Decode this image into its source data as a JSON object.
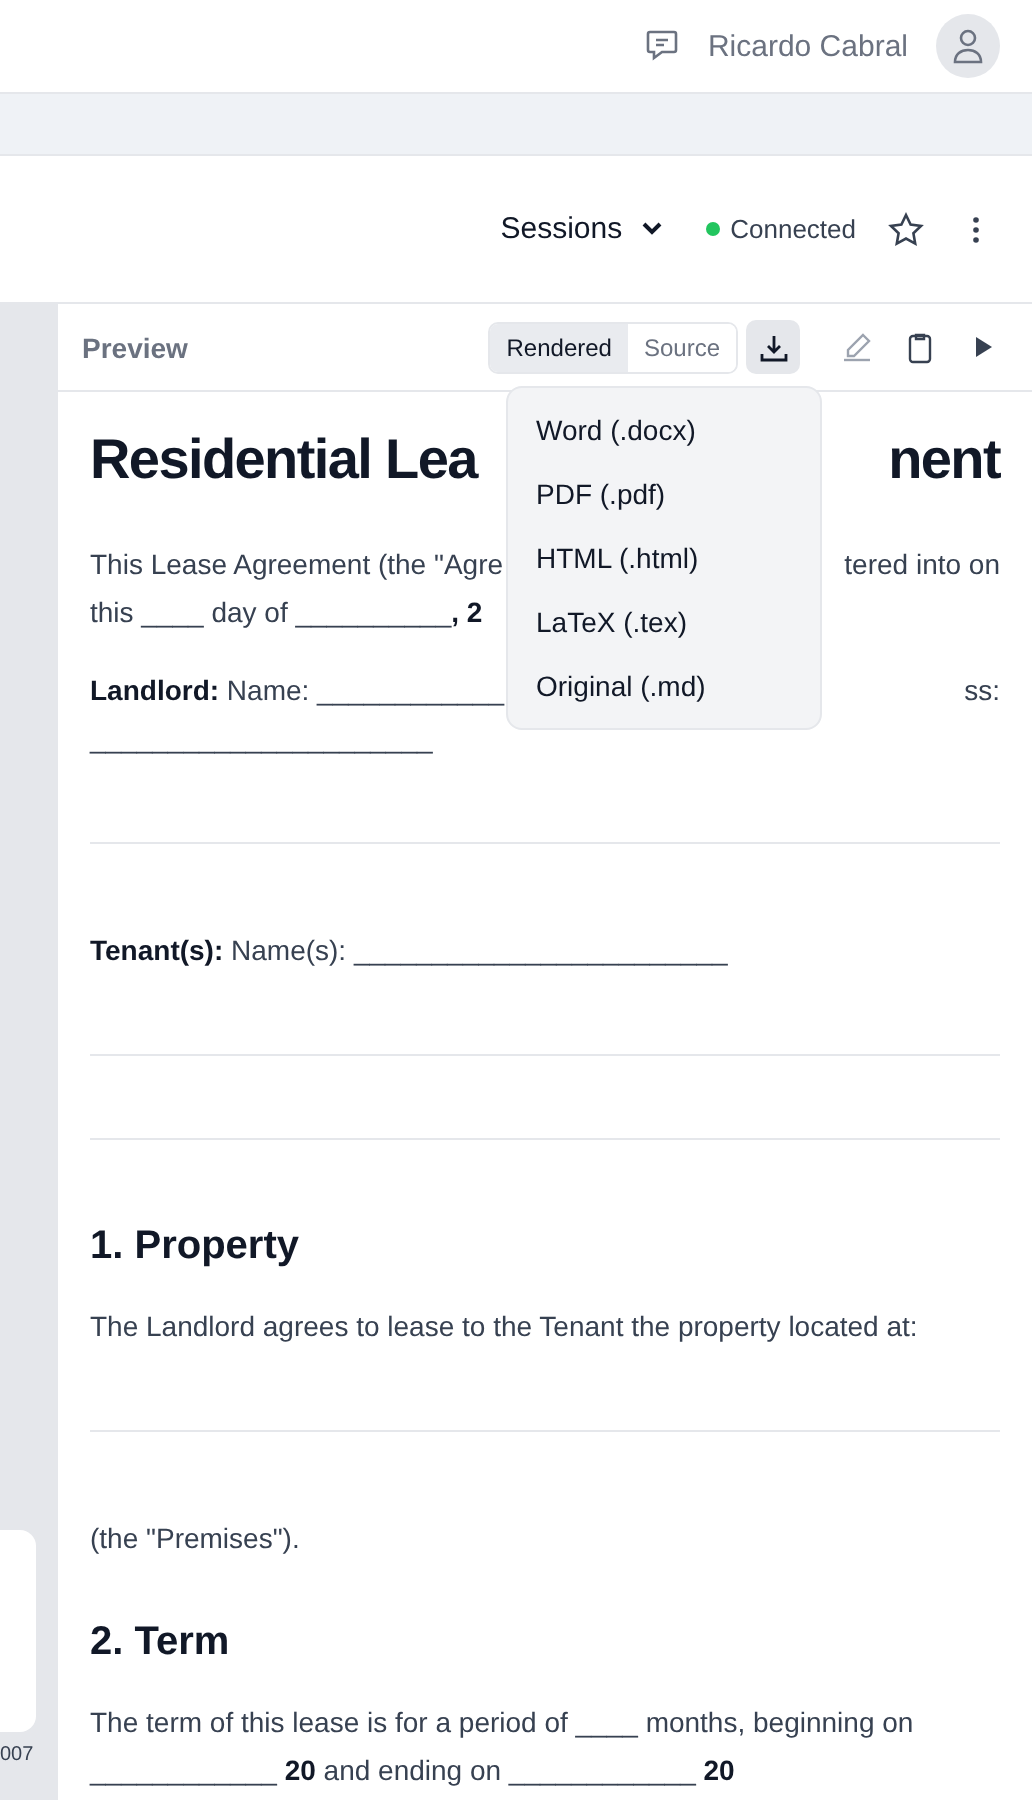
{
  "header": {
    "user_name": "Ricardo Cabral"
  },
  "toolbar": {
    "sessions_label": "Sessions",
    "status": {
      "label": "Connected",
      "color": "#22c55e"
    }
  },
  "side_strip": {
    "caption": "007"
  },
  "preview": {
    "title": "Preview",
    "views": [
      {
        "label": "Rendered",
        "selected": true
      },
      {
        "label": "Source",
        "selected": false
      }
    ],
    "download": {
      "expanded": true,
      "menu": [
        "Word (.docx)",
        "PDF (.pdf)",
        "HTML (.html)",
        "LaTeX (.tex)",
        "Original (.md)"
      ]
    }
  },
  "document": [
    {
      "kind": "title",
      "left": "Residential Lea",
      "right": "nent"
    },
    {
      "kind": "para",
      "lines": [
        {
          "left": "This Lease Agreement (the \"Agre",
          "right": "tered into on"
        },
        {
          "left": "this ____ day of __________**, 2**"
        }
      ]
    },
    {
      "kind": "para",
      "lines": [
        {
          "left": "**Landlord:** Name: ____________",
          "right": "ss:"
        },
        {
          "left": "______________________"
        }
      ]
    },
    {
      "kind": "rule"
    },
    {
      "kind": "para",
      "lines": [
        {
          "left": "**Tenant(s):** Name(s): ________________________"
        }
      ]
    },
    {
      "kind": "rule"
    },
    {
      "kind": "rule"
    },
    {
      "kind": "heading",
      "text": "1. Property"
    },
    {
      "kind": "para",
      "lines": [
        {
          "left": "The Landlord agrees to lease to the Tenant the property located at:"
        }
      ]
    },
    {
      "kind": "rule"
    },
    {
      "kind": "para",
      "lines": [
        {
          "left": "(the \"Premises\")."
        }
      ]
    },
    {
      "kind": "heading",
      "text": "2. Term"
    },
    {
      "kind": "para",
      "lines": [
        {
          "left": "The term of this lease is for a period of ____ months, beginning on"
        },
        {
          "left": "____________ **20** and ending on ____________ **20**"
        }
      ]
    }
  ]
}
